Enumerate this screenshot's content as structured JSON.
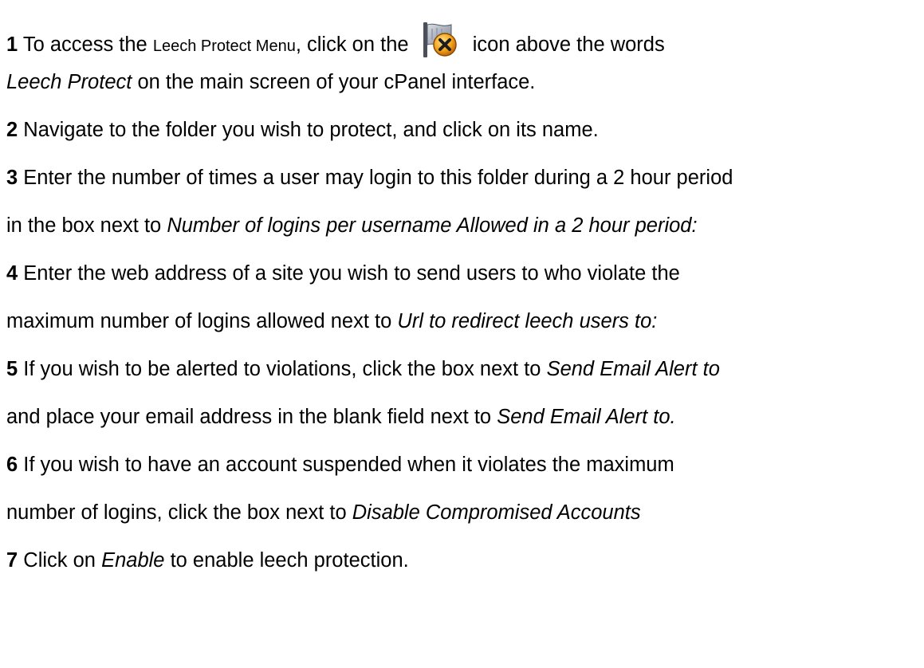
{
  "steps": [
    {
      "num": "1",
      "pre": "To access the",
      "menu_name": "Leech Protect Menu",
      "mid": ", click on the",
      "post": "icon above the words",
      "line2_italic": "Leech Protect",
      "line2_rest": "on the main screen of your cPanel interface.",
      "icon": "leech-protect-icon"
    },
    {
      "num": "2",
      "text": "Navigate to the folder you wish to protect, and click on its name."
    },
    {
      "num": "3",
      "line1": "Enter the number of times a user may login to this folder during a 2 hour period",
      "line2_pre": "in the box next to",
      "line2_italic": "Number of logins per username Allowed in a 2 hour period:"
    },
    {
      "num": "4",
      "line1": "Enter the web address of a site you wish to send users to who violate the",
      "line2_pre": "maximum number of logins allowed next to",
      "line2_italic": "Url to redirect leech users to:"
    },
    {
      "num": "5",
      "line1_pre": "If you wish to be alerted to violations, click the box next to",
      "line1_italic": "Send Email Alert to",
      "line2_pre": "and place your email address in the blank field next to",
      "line2_italic": "Send Email Alert to."
    },
    {
      "num": "6",
      "line1": "If you wish to have an account suspended when it violates the maximum",
      "line2_pre": "number of logins, click the box next to",
      "line2_italic": "Disable Compromised Accounts"
    },
    {
      "num": "7",
      "pre": "Click on",
      "italic": "Enable",
      "post": "to enable leech protection."
    }
  ]
}
